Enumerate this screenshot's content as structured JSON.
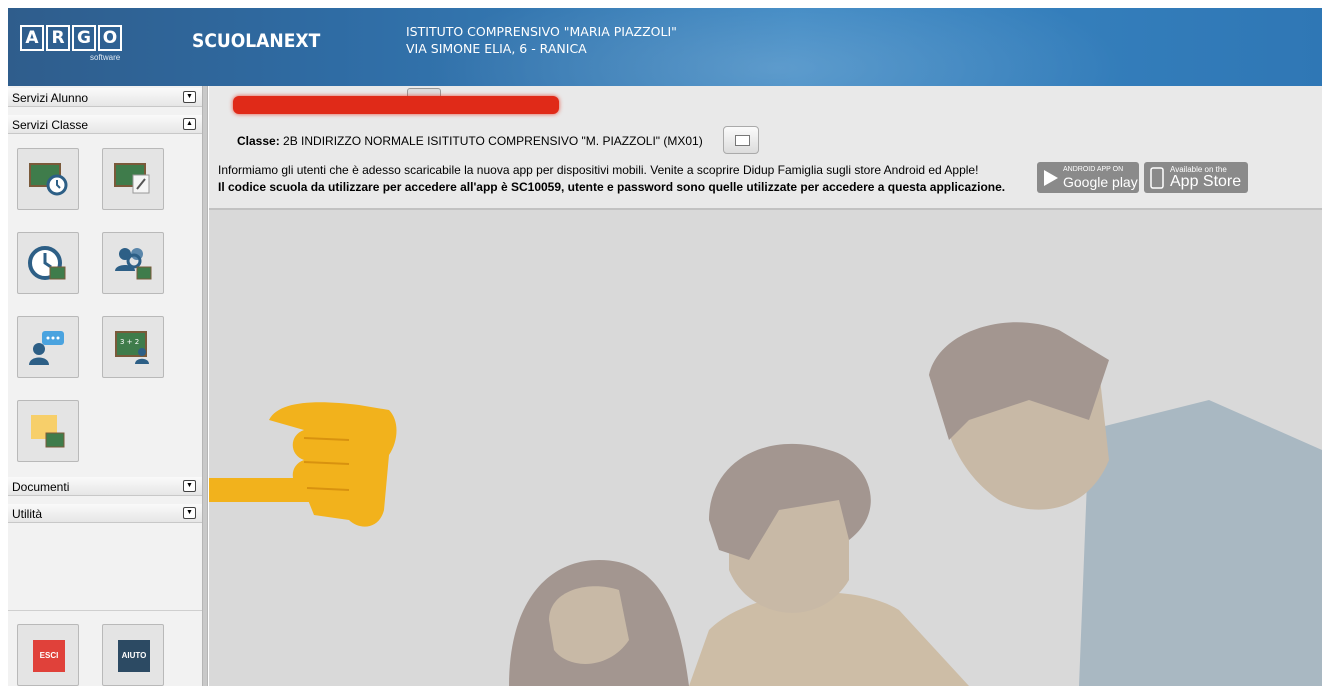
{
  "header": {
    "logo_letters": [
      "A",
      "R",
      "G",
      "O"
    ],
    "logo_sub": "software",
    "product": "SCUOLANEXT",
    "institute_line1": "ISTITUTO COMPRENSIVO \"MARIA PIAZZOLI\"",
    "institute_line2": "VIA SIMONE ELIA, 6 - RANICA"
  },
  "sidebar": {
    "sections": [
      {
        "label": "Servizi Alunno",
        "state": "collapsed"
      },
      {
        "label": "Servizi Classe",
        "state": "expanded"
      },
      {
        "label": "Documenti",
        "state": "collapsed"
      },
      {
        "label": "Utilità",
        "state": "collapsed"
      }
    ],
    "class_tiles": [
      "classroom-clock-icon",
      "classroom-edit-icon",
      "timetable-clock-icon",
      "students-search-icon",
      "teacher-message-icon",
      "blackboard-student-icon",
      "notes-board-icon"
    ],
    "bottom_buttons": {
      "exit_label": "ESCI",
      "help_label": "AIUTO"
    }
  },
  "main": {
    "classe_label": "Classe:",
    "classe_value": "2B INDIRIZZO NORMALE ISITITUTO COMPRENSIVO \"M. PIAZZOLI\" (MX01)",
    "info_line1": "Informiamo gli utenti che è adesso scaricabile la nuova app per dispositivi mobili. Venite a scoprire Didup Famiglia sugli store Android ed Apple!",
    "info_line2": "Il codice scuola da utilizzare per accedere all'app è SC10059, utente e password sono quelle utilizzate per accedere a questa applicazione.",
    "google_play_small": "ANDROID APP ON",
    "google_play": "Google play",
    "app_store_small": "Available on the",
    "app_store": "App Store"
  },
  "colors": {
    "header": "#2f6ca4",
    "exit_button": "#e0413a",
    "help_button": "#2c4a63",
    "redaction": "#e02a18",
    "pointer_emoji": "#f2b21c"
  }
}
